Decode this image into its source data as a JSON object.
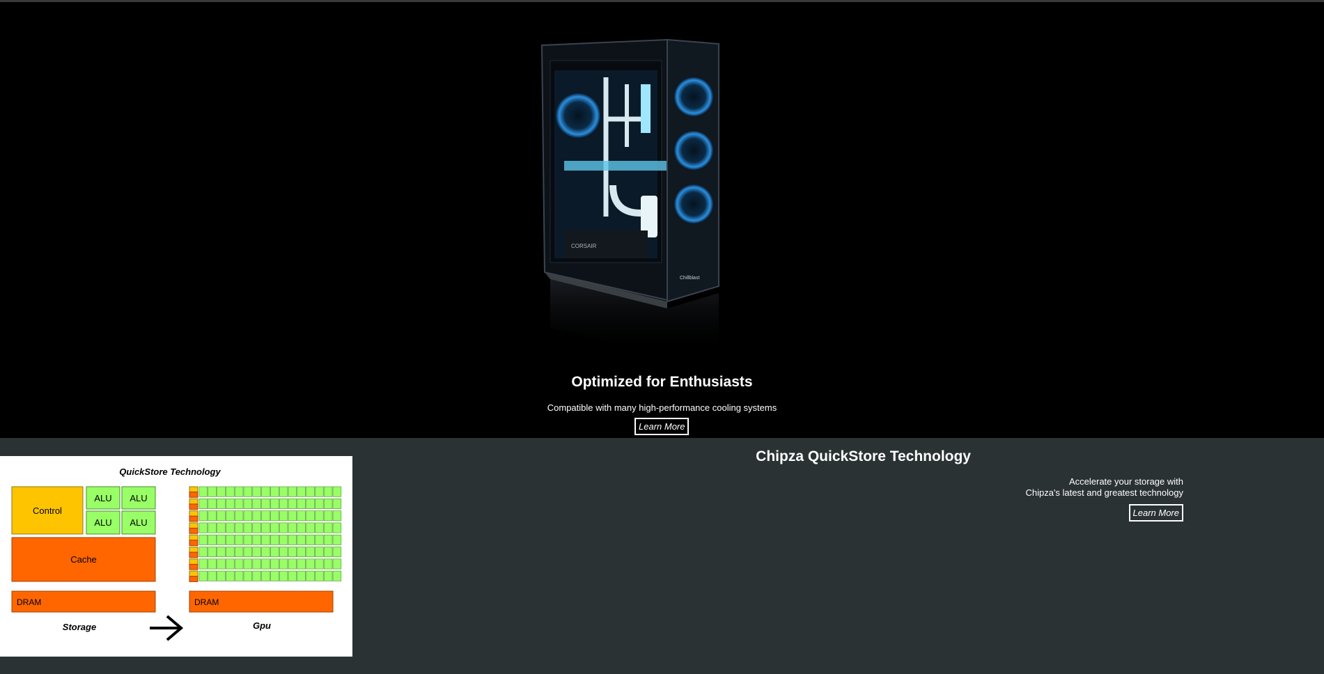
{
  "hero": {
    "title": "Optimized for Enthusiasts",
    "subtitle": "Compatible with many high-performance cooling systems",
    "button_label": "Learn More",
    "case_brand": "CORSAIR",
    "case_badge": "Chillblast"
  },
  "quickstore": {
    "title": "Chipza QuickStore Technology",
    "line1": "Accelerate your storage with",
    "line2": "Chipza's latest and greatest technology",
    "button_label": "Learn More"
  },
  "diagram": {
    "title": "QuickStore Technology",
    "control_label": "Control",
    "alu_label": "ALU",
    "cache_label": "Cache",
    "dram_left_label": "DRAM",
    "dram_right_label": "DRAM",
    "storage_label": "Storage",
    "gpu_label": "Gpu",
    "colors": {
      "control": "#ffc400",
      "alu": "#99ff66",
      "cache": "#ff6600",
      "dram": "#ff6600"
    }
  }
}
